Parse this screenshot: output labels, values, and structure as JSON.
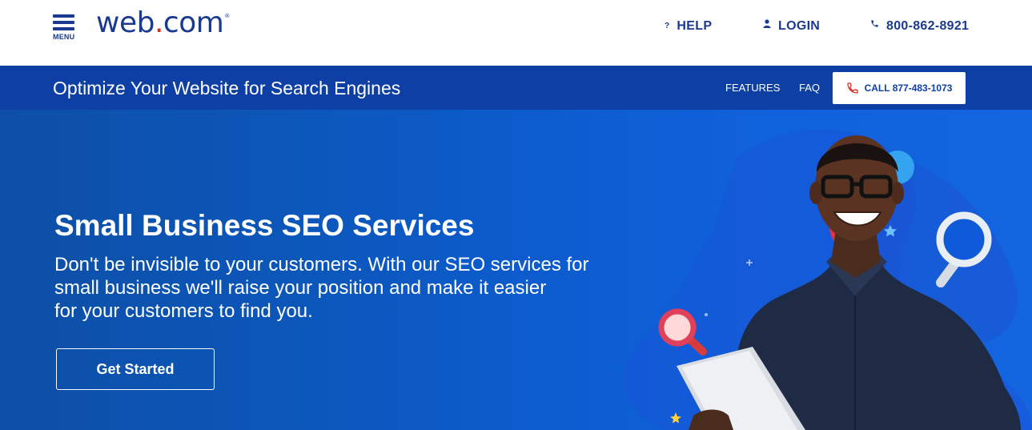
{
  "header": {
    "menu_label": "MENU",
    "logo_text": "web",
    "logo_dot": ".",
    "logo_suffix": "com",
    "logo_reg": "®",
    "help_label": "HELP",
    "login_label": "LOGIN",
    "phone_label": "800-862-8921",
    "icons": {
      "menu": "hamburger-icon",
      "help": "question-icon",
      "login": "user-icon",
      "phone": "phone-icon"
    }
  },
  "subnav": {
    "title": "Optimize Your Website for Search Engines",
    "features_label": "FEATURES",
    "faq_label": "FAQ",
    "call_label": "CALL 877-483-1073",
    "call_icon": "phone-icon"
  },
  "hero": {
    "title_light": "Small Business ",
    "title_bold": "SEO Services",
    "description_lines": [
      "Don't be invisible to your customers. With our SEO services for",
      "small business we'll raise your position and make it easier",
      "for your customers to find you."
    ],
    "cta_label": "Get Started",
    "image": "smiling-man-holding-tablet-with-magnifying-glasses"
  },
  "colors": {
    "brand_navy": "#1a3a8f",
    "logo_dot_red": "#e1251b",
    "subnav_blue": "#0e3fa5",
    "hero_blue": "#0d5cd0",
    "call_icon_red": "#e1251b"
  }
}
